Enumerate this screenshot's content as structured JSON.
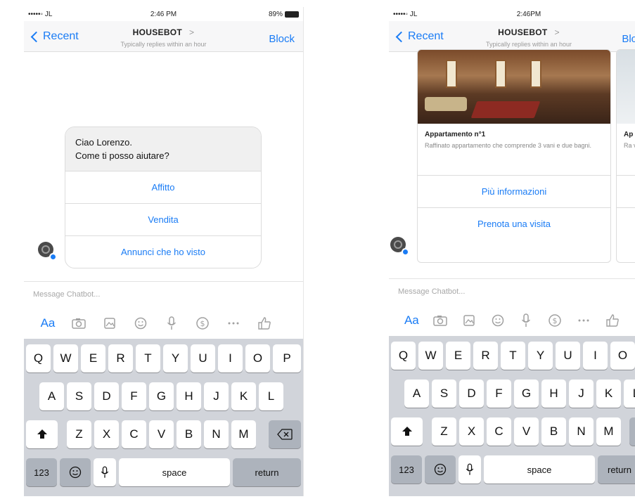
{
  "status": {
    "carrier": "•••••◦ JL",
    "time1": "2:46 PM",
    "time2": "2:46PM",
    "battery": "89%"
  },
  "nav": {
    "back": "Recent",
    "title": "HOUSEBOT",
    "arrow": ">",
    "subtitle": "Typically replies within an hour",
    "block": "Block"
  },
  "chat1": {
    "message_line1": "Ciao Lorenzo.",
    "message_line2": "Come ti posso aiutare?",
    "quick_replies": [
      "Affitto",
      "Vendita",
      "Annunci che ho visto"
    ]
  },
  "chat2": {
    "cards": [
      {
        "title": "Appartamento n°1",
        "description": "Raffinato appartamento che comprende 3 vani e due bagni.",
        "buttons": [
          "Più informazioni",
          "Prenota una visita"
        ]
      },
      {
        "title": "Ap",
        "description": "Ra va"
      }
    ]
  },
  "composer": {
    "placeholder": "Message Chatbot...",
    "aa": "Aa"
  },
  "icons": [
    "camera-icon",
    "gallery-icon",
    "emoji-icon",
    "mic-icon",
    "payment-icon",
    "more-icon",
    "like-icon"
  ],
  "keyboard": {
    "row1": [
      "Q",
      "W",
      "E",
      "R",
      "T",
      "Y",
      "U",
      "I",
      "O",
      "P"
    ],
    "row2": [
      "A",
      "S",
      "D",
      "F",
      "G",
      "H",
      "J",
      "K",
      "L"
    ],
    "row3": [
      "Z",
      "X",
      "C",
      "V",
      "B",
      "N",
      "M"
    ],
    "numbers": "123",
    "space": "space",
    "return": "return"
  },
  "colors": {
    "accent": "#1a7cf5",
    "keyboard_bg": "#d1d4da"
  }
}
